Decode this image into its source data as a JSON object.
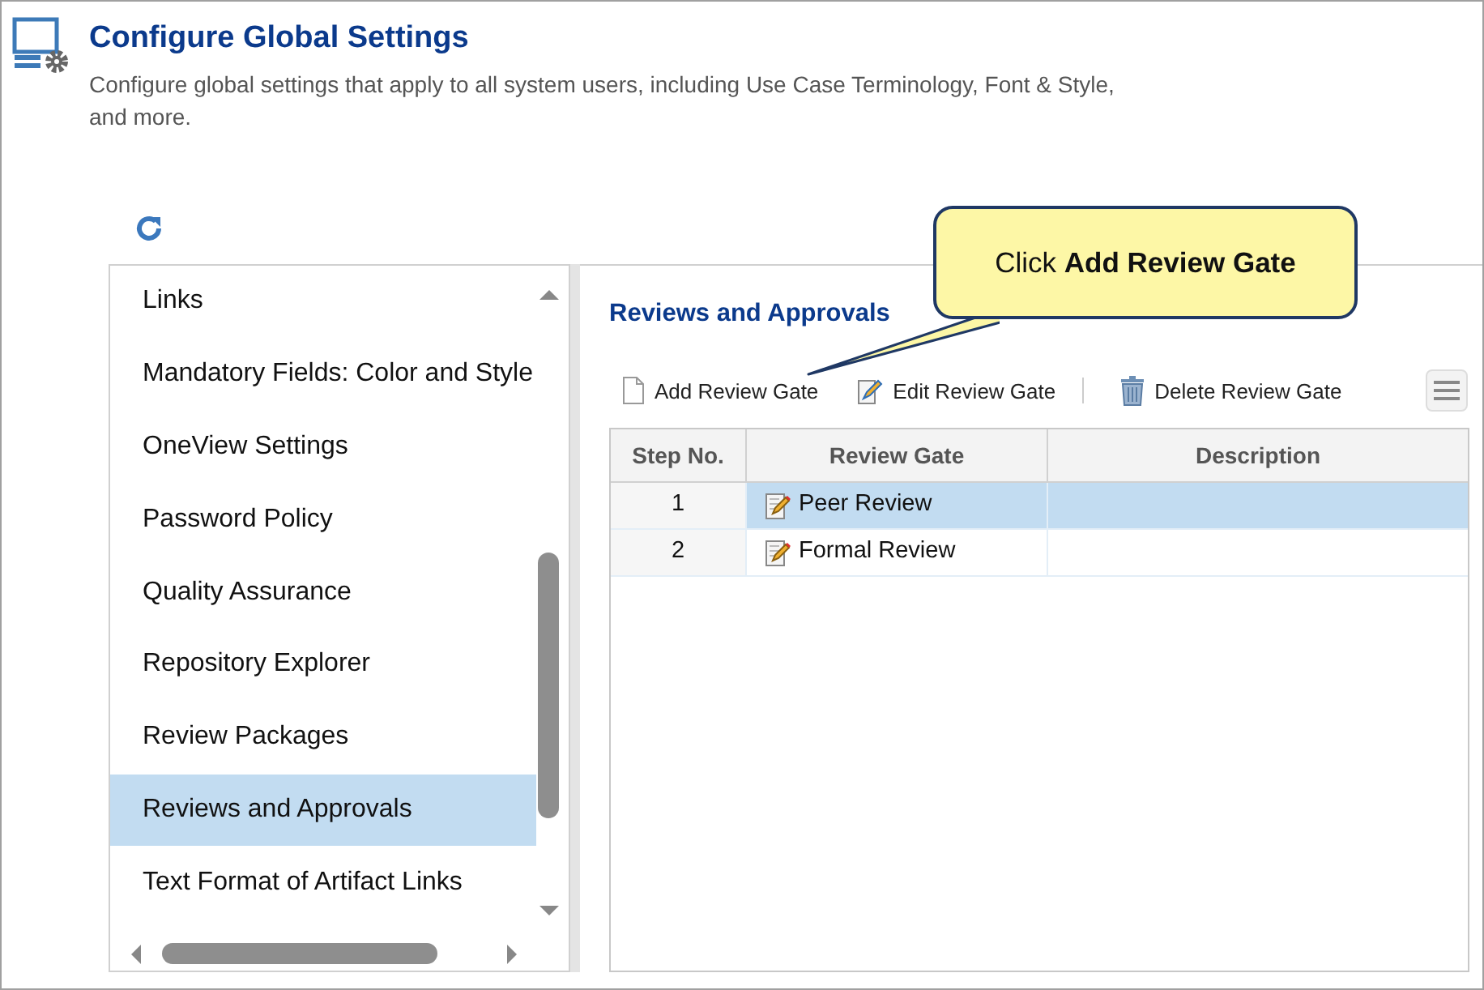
{
  "header": {
    "title": "Configure Global Settings",
    "description": "Configure global settings that apply to all system users, including Use Case Terminology, Font & Style, and more."
  },
  "sidebar": {
    "items": [
      {
        "label": "Links",
        "selected": false
      },
      {
        "label": "Mandatory Fields: Color and Style",
        "selected": false
      },
      {
        "label": "OneView Settings",
        "selected": false
      },
      {
        "label": "Password Policy",
        "selected": false
      },
      {
        "label": "Quality Assurance",
        "selected": false
      },
      {
        "label": "Repository Explorer",
        "selected": false
      },
      {
        "label": "Review Packages",
        "selected": false
      },
      {
        "label": "Reviews and Approvals",
        "selected": true
      },
      {
        "label": "Text Format of Artifact Links",
        "selected": false
      }
    ]
  },
  "panel": {
    "title": "Reviews and Approvals",
    "toolbar": [
      {
        "kind": "add",
        "label": "Add Review Gate"
      },
      {
        "kind": "edit",
        "label": "Edit Review Gate"
      },
      {
        "kind": "delete",
        "label": "Delete Review Gate"
      }
    ],
    "table": {
      "columns": [
        "Step No.",
        "Review Gate",
        "Description"
      ],
      "rows": [
        {
          "step": "1",
          "gate": "Peer Review",
          "selected": true
        },
        {
          "step": "2",
          "gate": "Formal Review",
          "selected": false
        }
      ]
    }
  },
  "callout": {
    "text": "Click **Add Review Gate**"
  }
}
